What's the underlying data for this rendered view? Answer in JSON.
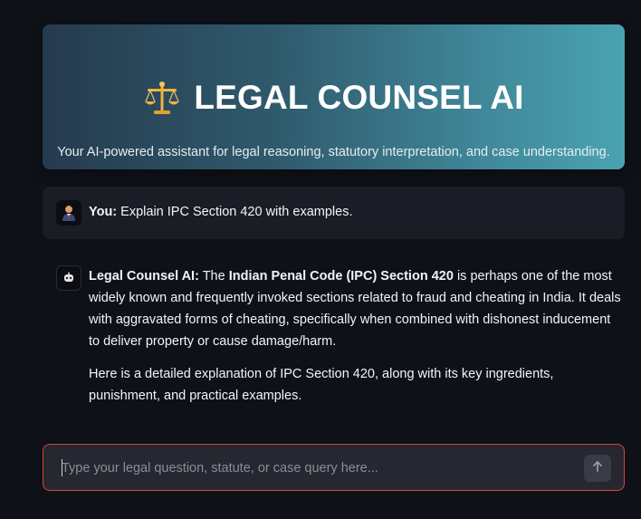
{
  "header": {
    "title": "LEGAL COUNSEL AI",
    "subtitle": "Your AI-powered assistant for legal reasoning, statutory interpretation, and case understanding.",
    "icon": "scales-icon"
  },
  "messages": {
    "user": {
      "avatar": "user-avatar-icon",
      "label": "You:",
      "text": "Explain IPC Section 420 with examples."
    },
    "assistant": {
      "avatar": "robot-icon",
      "label": "Legal Counsel AI:",
      "intro": "The",
      "bold_term": "Indian Penal Code (IPC) Section 420",
      "p1_rest": "is perhaps one of the most widely known and frequently invoked sections related to fraud and cheating in India. It deals with aggravated forms of cheating, specifically when combined with dishonest inducement to deliver property or cause damage/harm.",
      "p2": "Here is a detailed explanation of IPC Section 420, along with its key ingredients, punishment, and practical examples."
    }
  },
  "chat_input": {
    "placeholder": "Type your legal question, statute, or case query here...",
    "value": "",
    "send_icon": "arrow-up-icon"
  },
  "colors": {
    "background": "#0e1117",
    "input_border": "#d6453f",
    "header_gradient_start": "#263a4e",
    "header_gradient_end": "#4aa3b0"
  }
}
